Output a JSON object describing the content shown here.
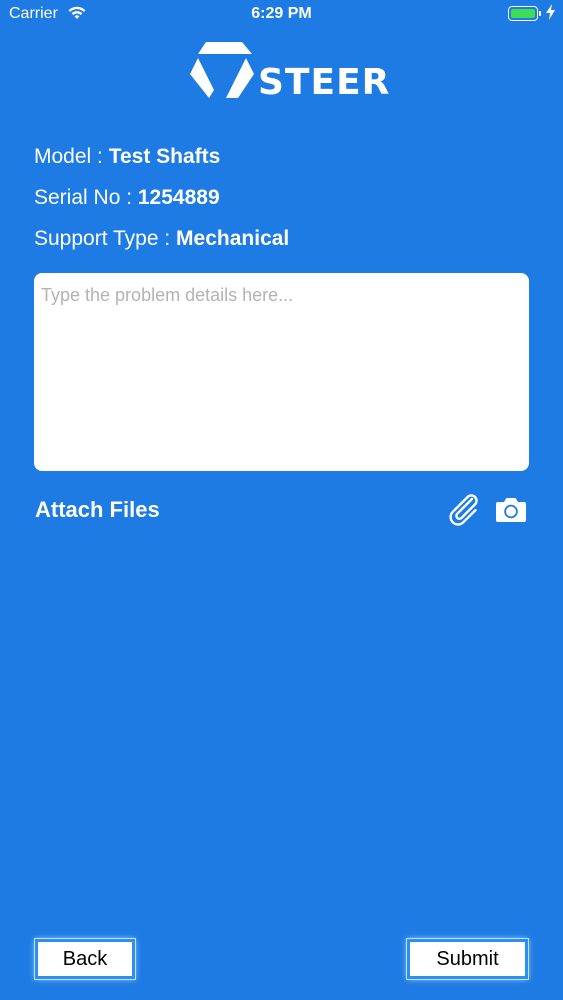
{
  "status_bar": {
    "carrier": "Carrier",
    "time": "6:29 PM",
    "battery_color": "#3fdc5a"
  },
  "logo": {
    "text": "STEER"
  },
  "info": {
    "model_label": "Model : ",
    "model_value": "Test Shafts",
    "serial_label": "Serial No : ",
    "serial_value": "1254889",
    "support_label": "Support Type : ",
    "support_value": "Mechanical"
  },
  "problem": {
    "placeholder": "Type the problem details here...",
    "value": ""
  },
  "attach": {
    "label": "Attach Files",
    "icons": [
      "paperclip-icon",
      "camera-icon"
    ]
  },
  "buttons": {
    "back": "Back",
    "submit": "Submit"
  },
  "colors": {
    "background": "#1d7be3",
    "button_border": "#2a91f0"
  }
}
